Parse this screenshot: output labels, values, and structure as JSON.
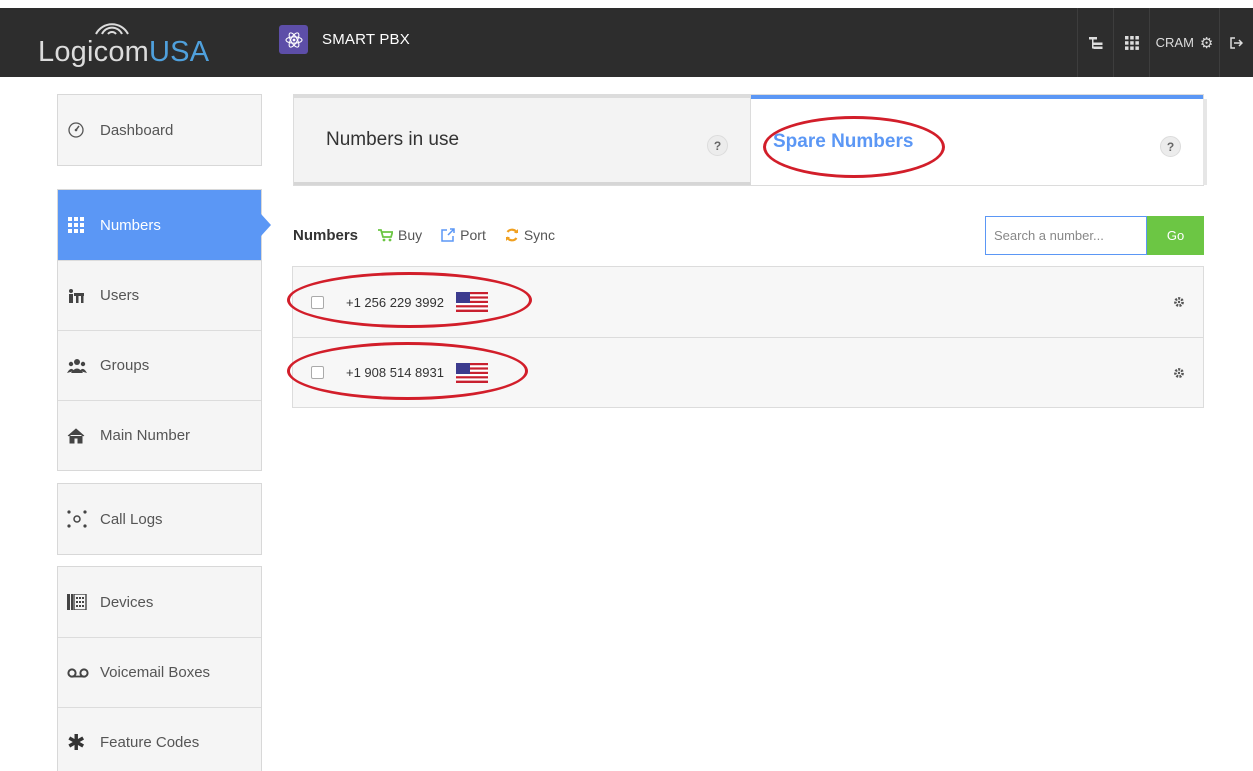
{
  "header": {
    "logo_text_main": "Logicom",
    "logo_text_accent": "USA",
    "app_name": "SMART PBX",
    "user_label": "CRAM"
  },
  "sidebar": {
    "groups": [
      {
        "items": [
          {
            "label": "Dashboard",
            "icon": "dashboard-icon"
          }
        ]
      },
      {
        "items": [
          {
            "label": "Numbers",
            "icon": "grid-icon",
            "active": true
          },
          {
            "label": "Users",
            "icon": "users-icon"
          },
          {
            "label": "Groups",
            "icon": "groups-icon"
          },
          {
            "label": "Main Number",
            "icon": "home-icon"
          }
        ]
      },
      {
        "items": [
          {
            "label": "Call Logs",
            "icon": "call-logs-icon"
          }
        ]
      },
      {
        "items": [
          {
            "label": "Devices",
            "icon": "devices-icon"
          },
          {
            "label": "Voicemail Boxes",
            "icon": "voicemail-icon"
          },
          {
            "label": "Feature Codes",
            "icon": "asterisk-icon"
          }
        ]
      }
    ]
  },
  "tabs": {
    "in_use": {
      "label": "Numbers in use",
      "help": "?"
    },
    "spare": {
      "label": "Spare Numbers",
      "help": "?"
    }
  },
  "toolbar": {
    "title": "Numbers",
    "buy": "Buy",
    "port": "Port",
    "sync": "Sync"
  },
  "search": {
    "placeholder": "Search a number...",
    "go": "Go"
  },
  "numbers": [
    {
      "number": "+1 256 229 3992",
      "country": "US"
    },
    {
      "number": "+1 908 514 8931",
      "country": "US"
    }
  ],
  "colors": {
    "accent": "#5b97f5",
    "topbar": "#2d2d2d",
    "go_button": "#6cc644",
    "annotation": "#d21e2a",
    "app_tile": "#5d4ea8"
  }
}
